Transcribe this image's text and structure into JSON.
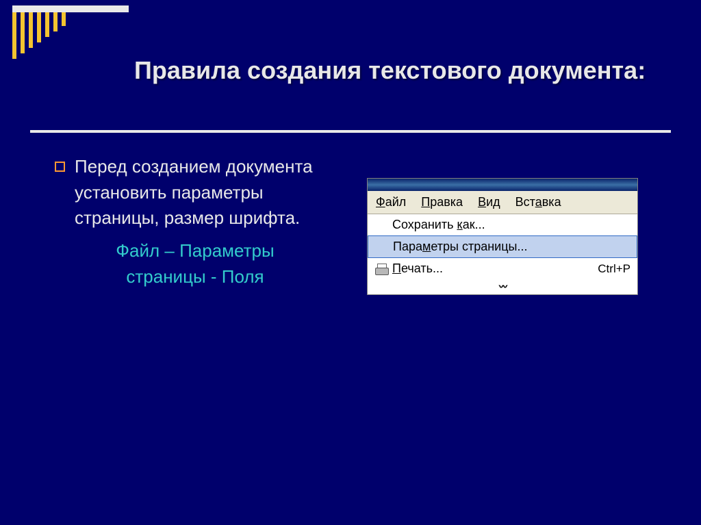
{
  "slide": {
    "title": "Правила создания текстового документа:",
    "bullet": "Перед созданием документа установить параметры страницы, размер шрифта.",
    "path": "Файл – Параметры страницы - Поля"
  },
  "app": {
    "menubar": [
      {
        "pre": "",
        "u": "Ф",
        "post": "айл"
      },
      {
        "pre": "",
        "u": "П",
        "post": "равка"
      },
      {
        "pre": "",
        "u": "В",
        "post": "ид"
      },
      {
        "pre": "Вст",
        "u": "а",
        "post": "вка"
      }
    ],
    "menu_items": {
      "save_as": {
        "pre": "Сохранить ",
        "u": "к",
        "post": "ак..."
      },
      "page_setup": {
        "pre": "Пара",
        "u": "м",
        "post": "етры страницы..."
      },
      "print": {
        "pre": "",
        "u": "П",
        "post": "ечать...",
        "shortcut": "Ctrl+P"
      }
    },
    "expand": "˅"
  }
}
